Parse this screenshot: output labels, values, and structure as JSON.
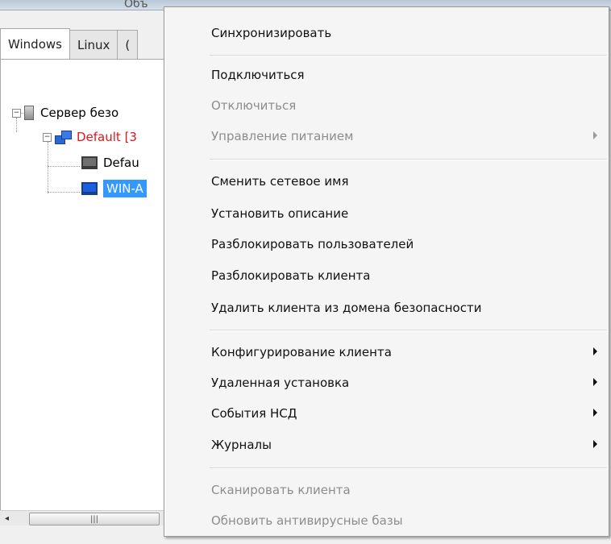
{
  "window": {
    "group_title": "Объ"
  },
  "tabs": [
    {
      "label": "Windows"
    },
    {
      "label": "Linux"
    },
    {
      "label": "("
    }
  ],
  "tree": {
    "server": "Сервер безо",
    "group": "Default [3",
    "client_1": "Defau",
    "client_2": "WIN-A"
  },
  "scrollbar": {
    "left_arrow": "◂",
    "thumb_grip": "|||"
  },
  "menu": {
    "items": [
      {
        "label": "Синхронизировать",
        "disabled": false,
        "submenu": false
      },
      {
        "label": "Подключиться",
        "disabled": false,
        "submenu": false
      },
      {
        "label": "Отключиться",
        "disabled": true,
        "submenu": false
      },
      {
        "label": "Управление питанием",
        "disabled": true,
        "submenu": true
      },
      {
        "label": "Сменить сетевое имя",
        "disabled": false,
        "submenu": false
      },
      {
        "label": "Установить описание",
        "disabled": false,
        "submenu": false
      },
      {
        "label": "Разблокировать пользователей",
        "disabled": false,
        "submenu": false
      },
      {
        "label": "Разблокировать клиента",
        "disabled": false,
        "submenu": false
      },
      {
        "label": "Удалить клиента из домена безопасности",
        "disabled": false,
        "submenu": false
      },
      {
        "label": "Конфигурирование клиента",
        "disabled": false,
        "submenu": true
      },
      {
        "label": "Удаленная установка",
        "disabled": false,
        "submenu": true
      },
      {
        "label": "События НСД",
        "disabled": false,
        "submenu": true
      },
      {
        "label": "Журналы",
        "disabled": false,
        "submenu": true
      },
      {
        "label": "Сканировать клиента",
        "disabled": true,
        "submenu": false
      },
      {
        "label": "Обновить антивирусные базы",
        "disabled": true,
        "submenu": false
      }
    ]
  },
  "colors": {
    "selection": "#3399ff",
    "group_label": "#e0161a",
    "disabled_text": "#8d8d8d"
  }
}
